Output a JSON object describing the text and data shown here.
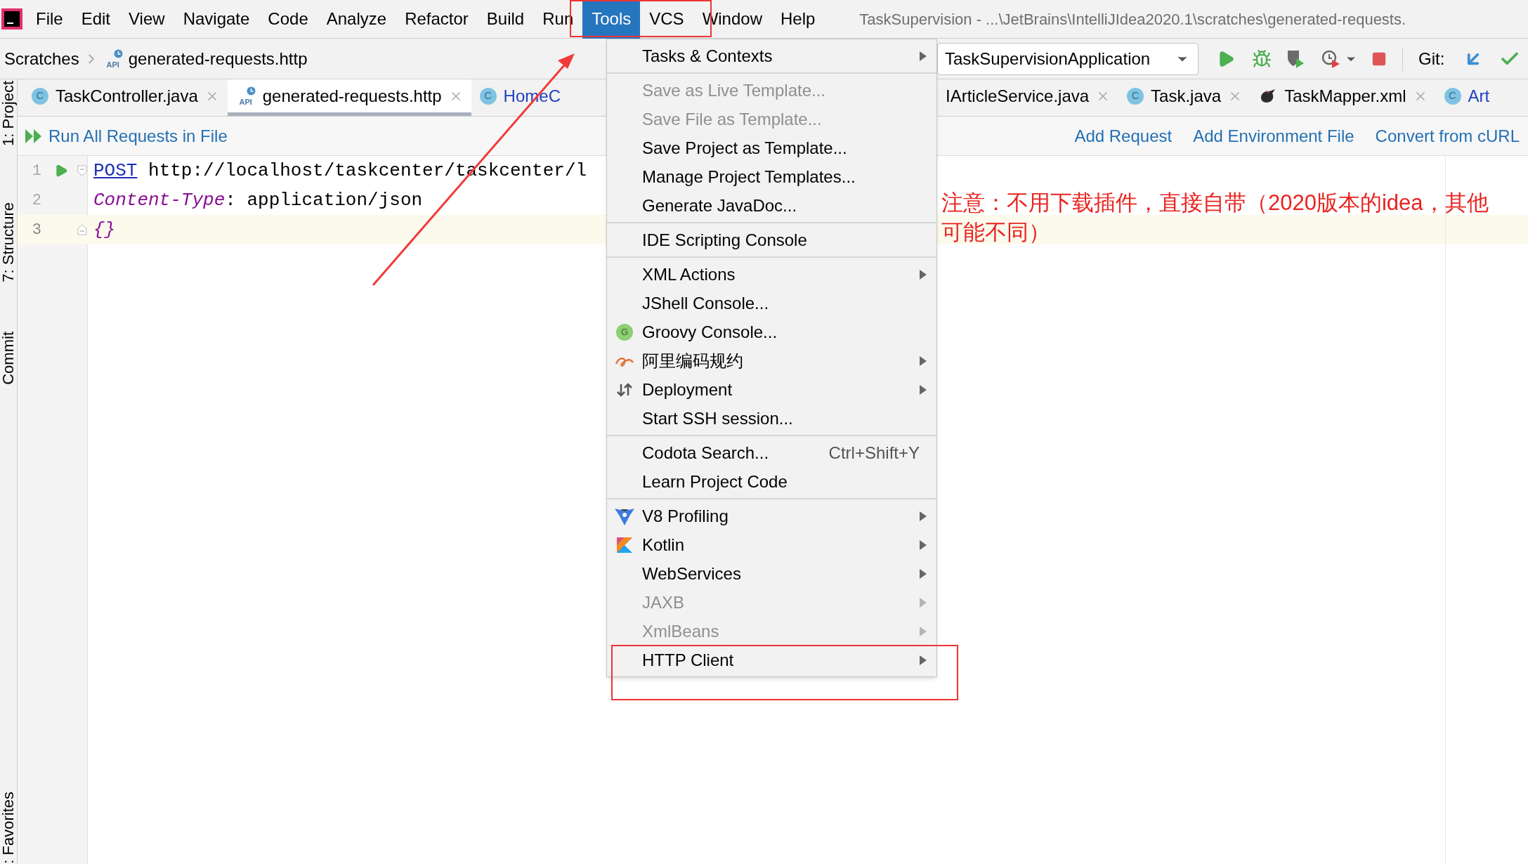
{
  "title_bar": {
    "menus": [
      {
        "label": "File",
        "selected": false
      },
      {
        "label": "Edit",
        "selected": false
      },
      {
        "label": "View",
        "selected": false
      },
      {
        "label": "Navigate",
        "selected": false
      },
      {
        "label": "Code",
        "selected": false
      },
      {
        "label": "Analyze",
        "selected": false
      },
      {
        "label": "Refactor",
        "selected": false
      },
      {
        "label": "Build",
        "selected": false
      },
      {
        "label": "Run",
        "selected": false
      },
      {
        "label": "Tools",
        "selected": true
      },
      {
        "label": "VCS",
        "selected": false
      },
      {
        "label": "Window",
        "selected": false
      },
      {
        "label": "Help",
        "selected": false
      }
    ],
    "title": "TaskSupervision - ...\\JetBrains\\IntelliJIdea2020.1\\scratches\\generated-requests."
  },
  "navigation_bar": {
    "breadcrumbs": [
      {
        "label": "Scratches",
        "kind": "folder"
      },
      {
        "label": "generated-requests.http",
        "kind": "http",
        "icon_text": "API"
      }
    ],
    "run_configuration": "TaskSupervisionApplication",
    "vcs_label": "Git:"
  },
  "tabs": [
    {
      "label": "TaskController.java",
      "kind": "class",
      "icon_text": "C",
      "selected": false,
      "closable": true
    },
    {
      "label": "generated-requests.http",
      "kind": "http",
      "icon_text": "API",
      "selected": true,
      "closable": true
    },
    {
      "label": "HomeC",
      "kind": "class",
      "icon_text": "C",
      "selected": false,
      "closable": false
    },
    {
      "label": "IArticleService.java",
      "kind": "plain",
      "selected": false,
      "closable": true
    },
    {
      "label": "Task.java",
      "kind": "class",
      "icon_text": "C",
      "selected": false,
      "closable": true
    },
    {
      "label": "TaskMapper.xml",
      "kind": "mapper",
      "selected": false,
      "closable": true
    },
    {
      "label": "Art",
      "kind": "class",
      "icon_text": "C",
      "selected": false,
      "closable": false
    }
  ],
  "http_toolbar": {
    "run_all": "Run All Requests in File",
    "actions": [
      "Add Request",
      "Add Environment File",
      "Convert from cURL"
    ]
  },
  "tool_windows": [
    {
      "label": "1: Project"
    },
    {
      "label": "7: Structure"
    },
    {
      "label": "Commit"
    },
    {
      "label": ": Favorites"
    }
  ],
  "editor": {
    "lines": [
      {
        "number": "1",
        "runnable": true,
        "fold_start": true,
        "fold_end": false,
        "current": false,
        "tokens": [
          {
            "kind": "method",
            "text": "POST"
          },
          {
            "kind": "plain",
            "text": " http://localhost/taskcenter/taskcenter/l"
          }
        ]
      },
      {
        "number": "2",
        "runnable": false,
        "fold_start": false,
        "fold_end": false,
        "current": false,
        "tokens": [
          {
            "kind": "header",
            "text": "Content-Type"
          },
          {
            "kind": "plain",
            "text": ": application/json"
          }
        ]
      },
      {
        "number": "3",
        "runnable": false,
        "fold_start": false,
        "fold_end": true,
        "current": true,
        "tokens": [
          {
            "kind": "brace",
            "text": "{}"
          }
        ]
      }
    ]
  },
  "tools_menu": {
    "groups": [
      {
        "items": [
          {
            "label": "Tasks & Contexts",
            "disabled": false,
            "submenu": true,
            "kind": "plain"
          }
        ]
      },
      {
        "items": [
          {
            "label": "Save as Live Template...",
            "disabled": true,
            "submenu": false,
            "kind": "plain"
          },
          {
            "label": "Save File as Template...",
            "disabled": true,
            "submenu": false,
            "kind": "plain"
          },
          {
            "label": "Save Project as Template...",
            "disabled": false,
            "submenu": false,
            "kind": "plain"
          },
          {
            "label": "Manage Project Templates...",
            "disabled": false,
            "submenu": false,
            "kind": "plain"
          },
          {
            "label": "Generate JavaDoc...",
            "disabled": false,
            "submenu": false,
            "kind": "plain"
          }
        ]
      },
      {
        "items": [
          {
            "label": "IDE Scripting Console",
            "disabled": false,
            "submenu": false,
            "kind": "plain"
          }
        ]
      },
      {
        "items": [
          {
            "label": "XML Actions",
            "disabled": false,
            "submenu": true,
            "kind": "plain"
          },
          {
            "label": "JShell Console...",
            "disabled": false,
            "submenu": false,
            "kind": "plain"
          },
          {
            "label": "Groovy Console...",
            "disabled": false,
            "submenu": false,
            "kind": "groovy",
            "icon_text": "G"
          },
          {
            "label": "阿里编码规约",
            "disabled": false,
            "submenu": true,
            "kind": "alibaba"
          },
          {
            "label": "Deployment",
            "disabled": false,
            "submenu": true,
            "kind": "deployment"
          },
          {
            "label": "Start SSH session...",
            "disabled": false,
            "submenu": false,
            "kind": "plain"
          }
        ]
      },
      {
        "items": [
          {
            "label": "Codota Search...",
            "shortcut": "Ctrl+Shift+Y",
            "disabled": false,
            "submenu": false,
            "kind": "plain"
          },
          {
            "label": "Learn Project Code",
            "disabled": false,
            "submenu": false,
            "kind": "plain"
          }
        ]
      },
      {
        "items": [
          {
            "label": "V8 Profiling",
            "disabled": false,
            "submenu": true,
            "kind": "v8"
          },
          {
            "label": "Kotlin",
            "disabled": false,
            "submenu": true,
            "kind": "kotlin"
          },
          {
            "label": "WebServices",
            "disabled": false,
            "submenu": true,
            "kind": "plain"
          },
          {
            "label": "JAXB",
            "disabled": true,
            "submenu": true,
            "kind": "plain"
          },
          {
            "label": "XmlBeans",
            "disabled": true,
            "submenu": true,
            "kind": "plain"
          },
          {
            "label": "HTTP Client",
            "disabled": false,
            "submenu": true,
            "kind": "plain"
          }
        ]
      }
    ]
  },
  "annotation": {
    "note_lines": [
      "注意：不用下载插件，直接自带（2020版本的idea，其他",
      "可能不同）"
    ]
  }
}
